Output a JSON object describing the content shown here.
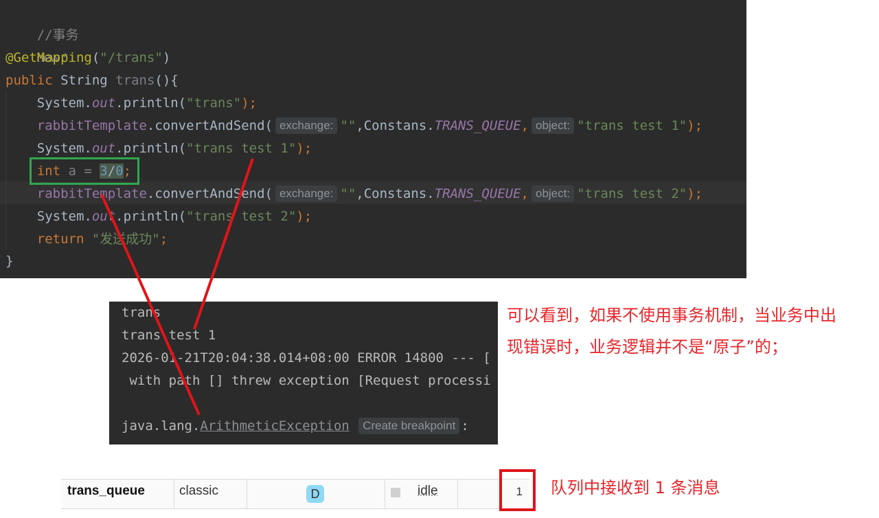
{
  "editor": {
    "lines": {
      "comment": "//事务",
      "usage_hint": "new *",
      "annotation": "@GetMapping",
      "mapping_path": "\"/trans\"",
      "kw_public": "public",
      "method_sig_type": "String",
      "method_name": "trans",
      "method_sig_rest": "(){",
      "sys": "System.",
      "out": "out",
      "println": ".println(",
      "str_trans": "\"trans\"",
      "close_semi": ");",
      "rabbit": "rabbitTemplate",
      "convert": ".convertAndSend(",
      "hint_exchange": "exchange:",
      "empty_str": "\"\"",
      "comma_constans": ",Constans.",
      "trans_queue_const": "TRANS_QUEUE",
      "comma": ",",
      "hint_object": "object:",
      "str_test1": "\"trans test 1\"",
      "str_test2": "\"trans test 2\"",
      "kw_int": "int",
      "var_a": " a = ",
      "expr_num1": "3",
      "expr_div": "/",
      "expr_num2": "0",
      "semi": ";",
      "kw_return": "return",
      "str_success": "\"发送成功\"",
      "close_brace": "}"
    }
  },
  "console": {
    "line1": "trans",
    "line2": "trans test 1",
    "line3": "2026-01-21T20:04:38.014+08:00 ERROR 14800 --- [",
    "line4": " with path [] threw exception [Request processi",
    "line5_prefix": "java.lang.",
    "exception_link": "ArithmeticException",
    "breakpoint_hint": "Create breakpoint",
    "line5_suffix": ":"
  },
  "annotations": {
    "note1": "可以看到，如果不使用事务机制，当业务中出",
    "note2": "现错误时，业务逻辑并不是“原子”的；",
    "note3": "队列中接收到 1 条消息"
  },
  "queue_row": {
    "name": "trans_queue",
    "type": "classic",
    "feature_badge": "D",
    "state": "idle",
    "ready_count": "1"
  },
  "colors": {
    "annotation_red": "#e8262b",
    "highlight_green": "#2fa84f",
    "badge_blue": "#8fd9f5"
  }
}
